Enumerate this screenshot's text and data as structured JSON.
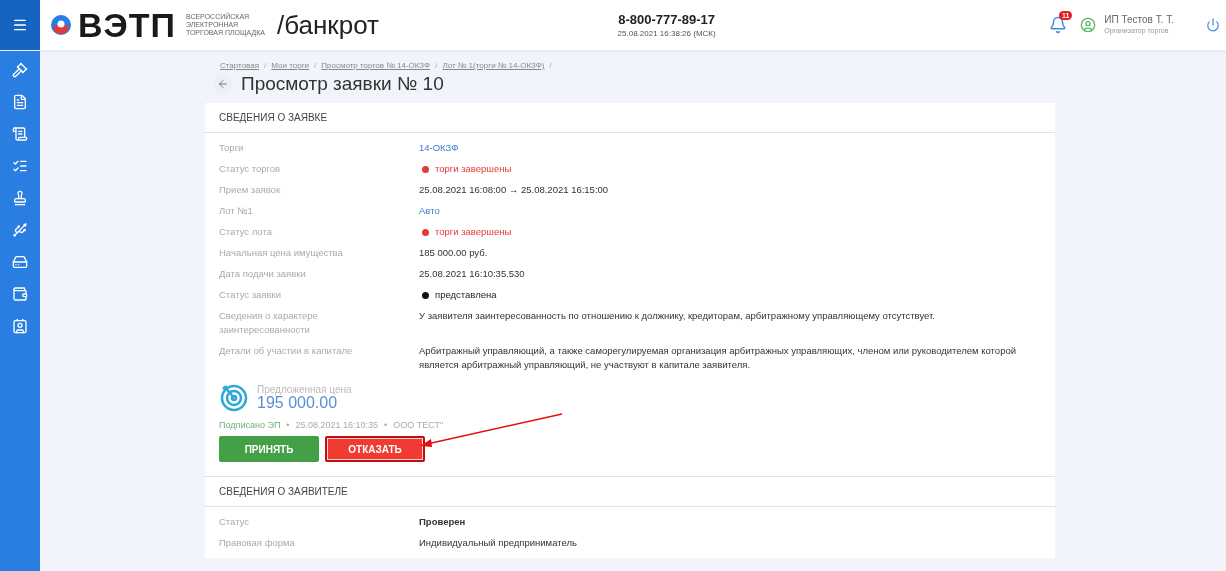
{
  "header": {
    "brand": "ВЭТП",
    "brand_caption": [
      "ВСЕРОССИЙСКАЯ",
      "ЭЛЕКТРОННАЯ",
      "ТОРГОВАЯ ПЛОЩАДКА"
    ],
    "section": "/банкрот",
    "phone": "8-800-777-89-17",
    "datetime": "25.08.2021 16:38:26 (МСК)",
    "notifications": "11",
    "user_name": "ИП Тестов Т. Т.",
    "user_role": "Организатор торгов"
  },
  "breadcrumb_separator": "/",
  "signature_separator": "•",
  "breadcrumbs": [
    "Стартовая",
    "Мои торги",
    "Просмотр торгов № 14-ОКЗФ",
    "Лот № 1(торги № 14-ОКЗФ)"
  ],
  "title": "Просмотр заявки № 10",
  "application": {
    "heading": "СВЕДЕНИЯ О ЗАЯВКЕ",
    "rows": [
      {
        "label": "Торги",
        "value": "14-ОКЗФ",
        "kind": "link"
      },
      {
        "label": "Статус торгов",
        "value": "торги завершены",
        "kind": "status",
        "color": "#e53935"
      },
      {
        "label": "Прием заявок",
        "value": "25.08.2021 16:08:00 → 25.08.2021 16:15:00",
        "kind": "text"
      },
      {
        "label": "Лот №1",
        "value": "Авто",
        "kind": "link"
      },
      {
        "label": "Статус лота",
        "value": "торги завершены",
        "kind": "status",
        "color": "#e53935"
      },
      {
        "label": "Начальная цена имущества",
        "value": "185 000.00 руб.",
        "kind": "text"
      },
      {
        "label": "Дата подачи заявки",
        "value": "25.08.2021 16:10:35.530",
        "kind": "text"
      },
      {
        "label": "Статус заявки",
        "value": "представлена",
        "kind": "status",
        "color": "#111111"
      },
      {
        "label": "Сведения о характере заинтересованности",
        "value": "У заявителя заинтересованность по отношению к должнику, кредиторам, арбитражному управляющему отсутствует.",
        "kind": "text"
      },
      {
        "label": "Детали об участии в капитале",
        "value": "Арбитражный управляющий, а также саморегулируемая организация арбитражных управляющих, членом или руководителем которой является арбитражный управляющий, не участвуют в капитале заявителя.",
        "kind": "text"
      }
    ],
    "offer_label": "Предложенная цена",
    "offer_value": "195 000.00",
    "signature": [
      "Подписано ЭП",
      "25.08.2021 16:10:35",
      "ООО ТЕСТ\""
    ],
    "buttons": [
      {
        "label": "ПРИНЯТЬ",
        "kind": "accept",
        "highlighted": false
      },
      {
        "label": "ОТКАЗАТЬ",
        "kind": "reject",
        "highlighted": true
      }
    ]
  },
  "applicant": {
    "heading": "СВЕДЕНИЯ О ЗАЯВИТЕЛЕ",
    "rows": [
      {
        "label": "Статус",
        "value": "Проверен",
        "kind": "bold"
      },
      {
        "label": "Правовая форма",
        "value": "Индивидуальный предприниматель",
        "kind": "text"
      }
    ]
  }
}
